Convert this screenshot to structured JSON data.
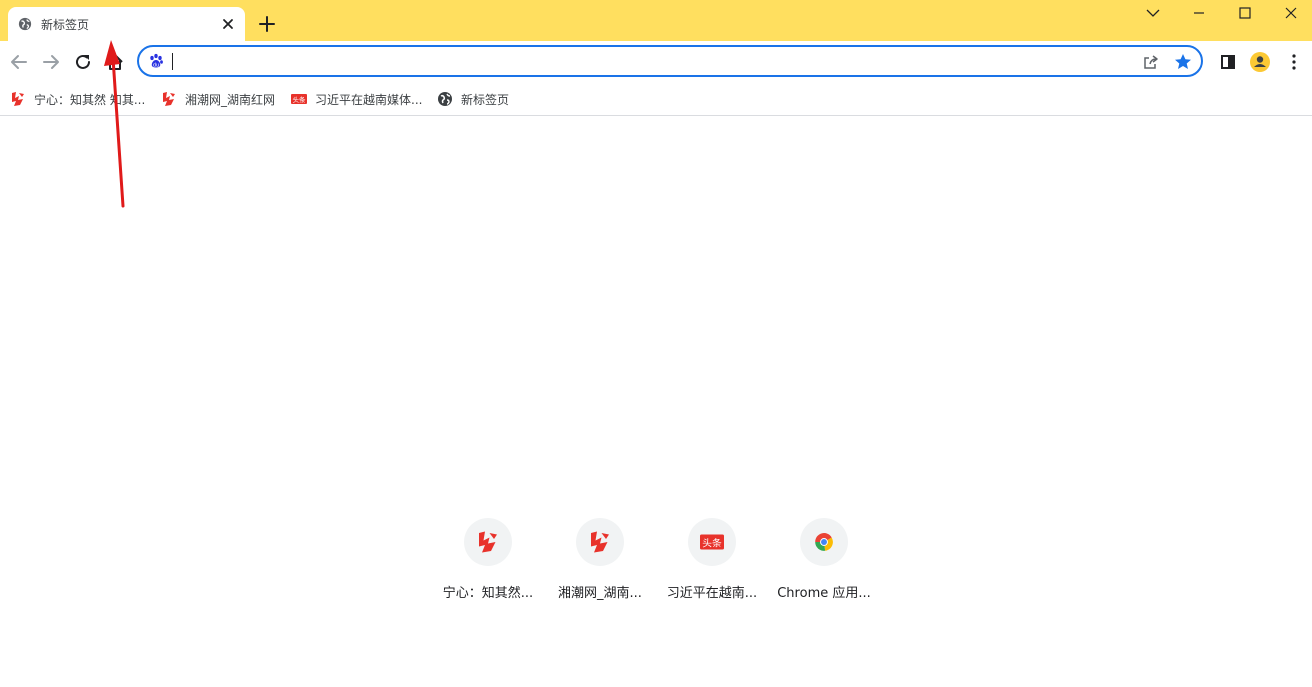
{
  "window": {
    "tab_title": "新标签页",
    "controls": [
      "chevron-down-icon",
      "minimize-icon",
      "maximize-icon",
      "close-icon"
    ]
  },
  "omnibox": {
    "value": "",
    "placeholder": ""
  },
  "bookmarks": [
    {
      "label": "宁心：知其然 知其...",
      "icon": "xiangchao-logo-icon"
    },
    {
      "label": "湘潮网_湖南红网",
      "icon": "xiangchao-logo-icon"
    },
    {
      "label": "习近平在越南媒体...",
      "icon": "toutiao-logo-icon"
    },
    {
      "label": "新标签页",
      "icon": "globe-icon"
    }
  ],
  "shortcuts": [
    {
      "label": "宁心：知其然...",
      "icon": "xiangchao-logo-icon"
    },
    {
      "label": "湘潮网_湖南...",
      "icon": "xiangchao-logo-icon"
    },
    {
      "label": "习近平在越南...",
      "icon": "toutiao-logo-icon"
    },
    {
      "label": "Chrome 应用...",
      "icon": "chrome-logo-icon"
    }
  ],
  "toutiao_badge": "头条",
  "colors": {
    "tabstrip": "#ffdf5f",
    "omnibox_border": "#1a73e8",
    "star": "#1a73e8",
    "brand_red": "#e8322b",
    "avatar": "#fcc934",
    "annotation_arrow": "#e01a1a"
  }
}
